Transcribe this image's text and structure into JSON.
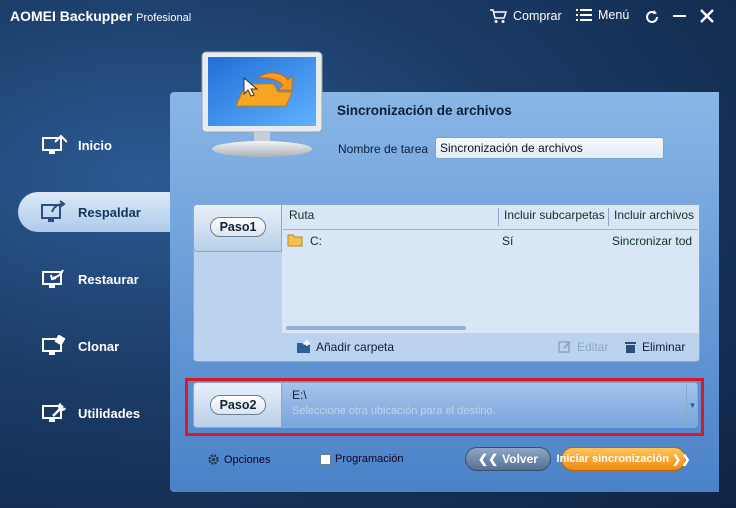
{
  "app": {
    "name": "AOMEI Backupper",
    "edition": "Profesional"
  },
  "titlebar": {
    "buy_label": "Comprar",
    "menu_label": "Menú"
  },
  "sidebar": {
    "items": [
      {
        "label": "Inicio",
        "icon": "home-icon"
      },
      {
        "label": "Respaldar",
        "icon": "backup-icon",
        "active": true
      },
      {
        "label": "Restaurar",
        "icon": "restore-icon"
      },
      {
        "label": "Clonar",
        "icon": "clone-icon"
      },
      {
        "label": "Utilidades",
        "icon": "tools-icon"
      }
    ]
  },
  "header": {
    "title": "Sincronización de archivos",
    "task_name_label": "Nombre de tarea",
    "task_name_value": "Sincronización de archivos"
  },
  "step1": {
    "label": "Paso1",
    "columns": [
      "Ruta",
      "Incluir subcarpetas",
      "Incluir archivos"
    ],
    "rows": [
      {
        "path": "C:",
        "subfolders": "Sí",
        "files": "Sincronizar tod"
      }
    ],
    "add_folder_label": "Añadir carpeta",
    "edit_label": "Editar",
    "delete_label": "Eliminar"
  },
  "step2": {
    "label": "Paso2",
    "destination": "E:\\",
    "hint": "Seleccione otra ubicación para el destino."
  },
  "footer": {
    "options_label": "Opciones",
    "schedule_label": "Programación",
    "back_label": "Volver",
    "start_label": "Iniciar sincronización"
  },
  "colors": {
    "highlight": "#d9182a",
    "accent_orange": "#f08a12",
    "panel_blue": "#6c9fd9"
  }
}
